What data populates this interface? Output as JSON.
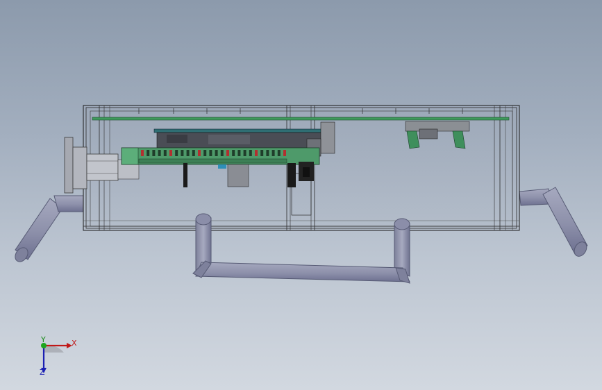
{
  "app": {
    "view": "cad-3d-viewport"
  },
  "model": {
    "description_parts": [
      "enclosure-box",
      "circuit-board",
      "terminal-strip",
      "connector-board",
      "round-connector",
      "tube-handle",
      "tube-legs"
    ]
  },
  "triad": {
    "x_label": "X",
    "y_label": "Y",
    "z_label": "Z"
  },
  "colors": {
    "background_top": "#8c9aac",
    "background_bottom": "#d2d8e0",
    "tube": "#8e91ab",
    "pcb_green": "#3d8a55",
    "wire": "#1a1a1a"
  }
}
